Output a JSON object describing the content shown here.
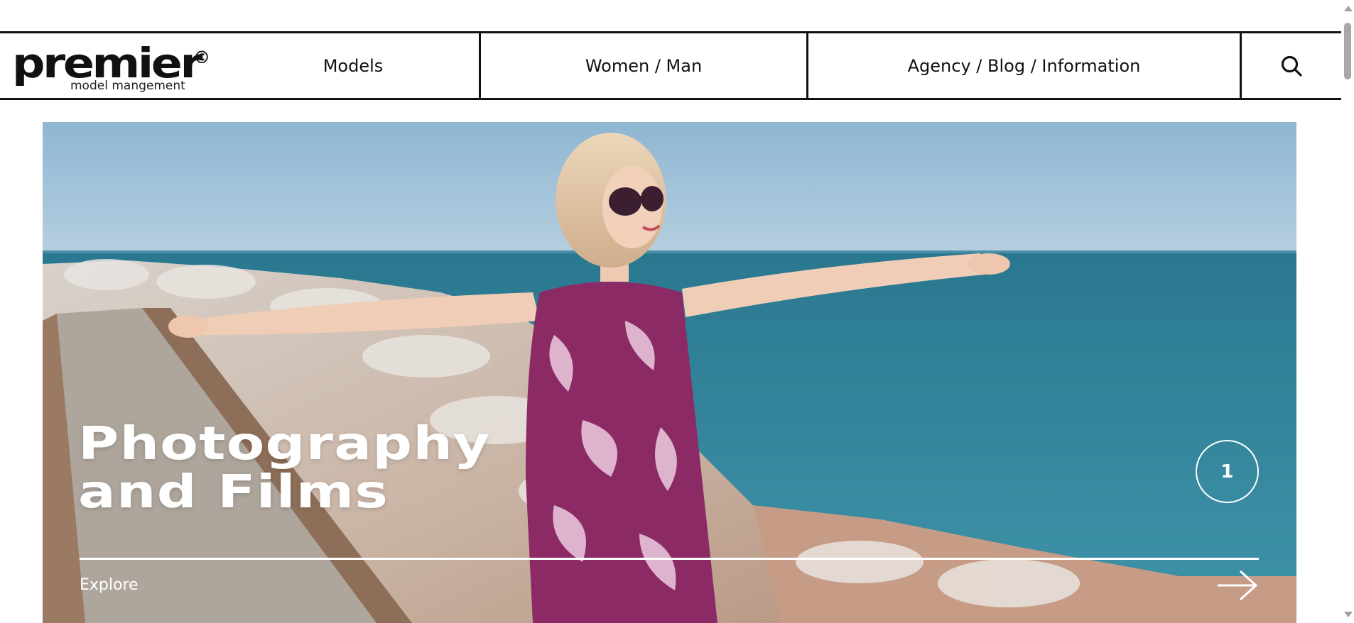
{
  "brand": {
    "name": "premier",
    "copyright_mark": "©",
    "tagline": "model mangement"
  },
  "nav": {
    "items": [
      {
        "label": "Models"
      },
      {
        "label": "Women / Man"
      },
      {
        "label": "Agency / Blog / Information"
      }
    ],
    "search_icon": "search-icon"
  },
  "hero": {
    "title_line1": "Photography",
    "title_line2": "and Films",
    "slide_number": "1",
    "cta_label": "Explore",
    "cta_icon": "arrow-right-icon"
  },
  "colors": {
    "text": "#111111",
    "hero_text": "#ffffff",
    "sky": "#9fbed6",
    "sea": "#2f7f96",
    "dress": "#8c2a66"
  }
}
